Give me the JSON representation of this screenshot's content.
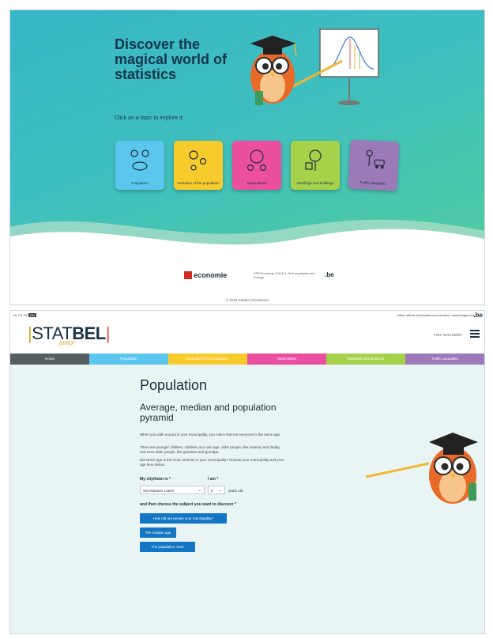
{
  "explore": {
    "title": "Discover the magical world of statistics",
    "instruction": "Click on a topic to explore it:",
    "topics": [
      {
        "label": "Population",
        "color": "#5bc7ee"
      },
      {
        "label": "Evolution of the population",
        "color": "#f7cb2c"
      },
      {
        "label": "Nationalities",
        "color": "#ec4f9f"
      },
      {
        "label": "Dwellings and buildings",
        "color": "#a6d14a"
      },
      {
        "label": "Traffic casualties",
        "color": "#9c79b8"
      }
    ],
    "footer": {
      "economie": "economie",
      "fps_text": "FPS Economy, S.M.E.s, Self-employed and Energy",
      "be": ".be",
      "copyright": "© 2016 Statbel | Disclaimer"
    }
  },
  "population_page": {
    "languages": [
      "NL",
      "FR",
      "DE",
      "EN"
    ],
    "official_info": "Other official information and services: www.belgium.be",
    "be": ".be",
    "logo": {
      "stat": "STAT",
      "bel": "BEL",
      "junior": "junior"
    },
    "for_teachers": "FOR TEACHERS",
    "nav": [
      {
        "label": "Home",
        "color": "#555e63"
      },
      {
        "label": "Population",
        "color": "#5bc7ee"
      },
      {
        "label": "Evolution of the population",
        "color": "#f7cb2c"
      },
      {
        "label": "Nationalities",
        "color": "#ec4f9f"
      },
      {
        "label": "Dwellings and buildings",
        "color": "#a6d14a"
      },
      {
        "label": "Traffic casualties",
        "color": "#9c79b8"
      }
    ],
    "title": "Population",
    "subtitle": "Average, median and population pyramid",
    "paragraphs": [
      "When you walk around in your municipality, you notice that not everyone is the same age.",
      "There are younger children, children your own age, older people, like mommy and daddy, and even older people, like grandma and grandpa.",
      "But which age is the most common in your municipality? Choose your municipality and your age here below."
    ],
    "form": {
      "city_label": "My city/town is *",
      "city_value": "Sint-Marians-Latem",
      "age_label": "I am *",
      "age_value": "8",
      "years_old": "years old",
      "choose_label": "and then choose the subject you want to discover *"
    },
    "buttons": [
      "How old are people your municipality?",
      "The median age",
      "The population chart"
    ]
  }
}
